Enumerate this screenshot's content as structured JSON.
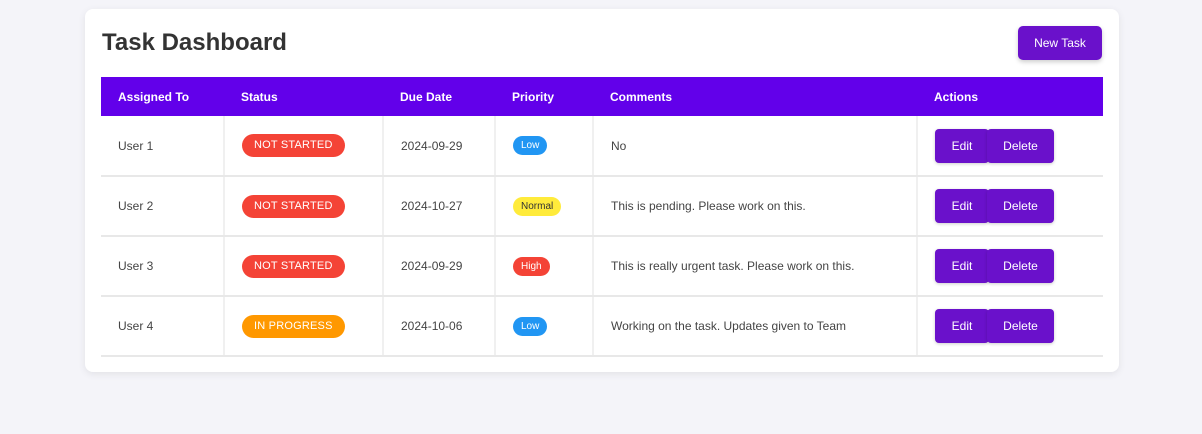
{
  "header": {
    "title": "Task Dashboard",
    "new_task_label": "New Task"
  },
  "table": {
    "columns": [
      "Assigned To",
      "Status",
      "Due Date",
      "Priority",
      "Comments",
      "Actions"
    ],
    "rows": [
      {
        "assigned_to": "User 1",
        "status": "NOT STARTED",
        "due_date": "2024-09-29",
        "priority": "Low",
        "comments": "No",
        "edit_label": "Edit",
        "delete_label": "Delete"
      },
      {
        "assigned_to": "User 2",
        "status": "NOT STARTED",
        "due_date": "2024-10-27",
        "priority": "Normal",
        "comments": "This is pending. Please work on this.",
        "edit_label": "Edit",
        "delete_label": "Delete"
      },
      {
        "assigned_to": "User 3",
        "status": "NOT STARTED",
        "due_date": "2024-09-29",
        "priority": "High",
        "comments": "This is really urgent task. Please work on this.",
        "edit_label": "Edit",
        "delete_label": "Delete"
      },
      {
        "assigned_to": "User 4",
        "status": "IN PROGRESS",
        "due_date": "2024-10-06",
        "priority": "Low",
        "comments": "Working on the task. Updates given to Team",
        "edit_label": "Edit",
        "delete_label": "Delete"
      }
    ]
  },
  "colors": {
    "accent": "#6a11cb",
    "header_bg": "#6200ea",
    "status_not_started": "#f44336",
    "status_in_progress": "#ff9800",
    "priority_low": "#2196f3",
    "priority_normal": "#ffeb3b",
    "priority_high": "#f44336"
  }
}
